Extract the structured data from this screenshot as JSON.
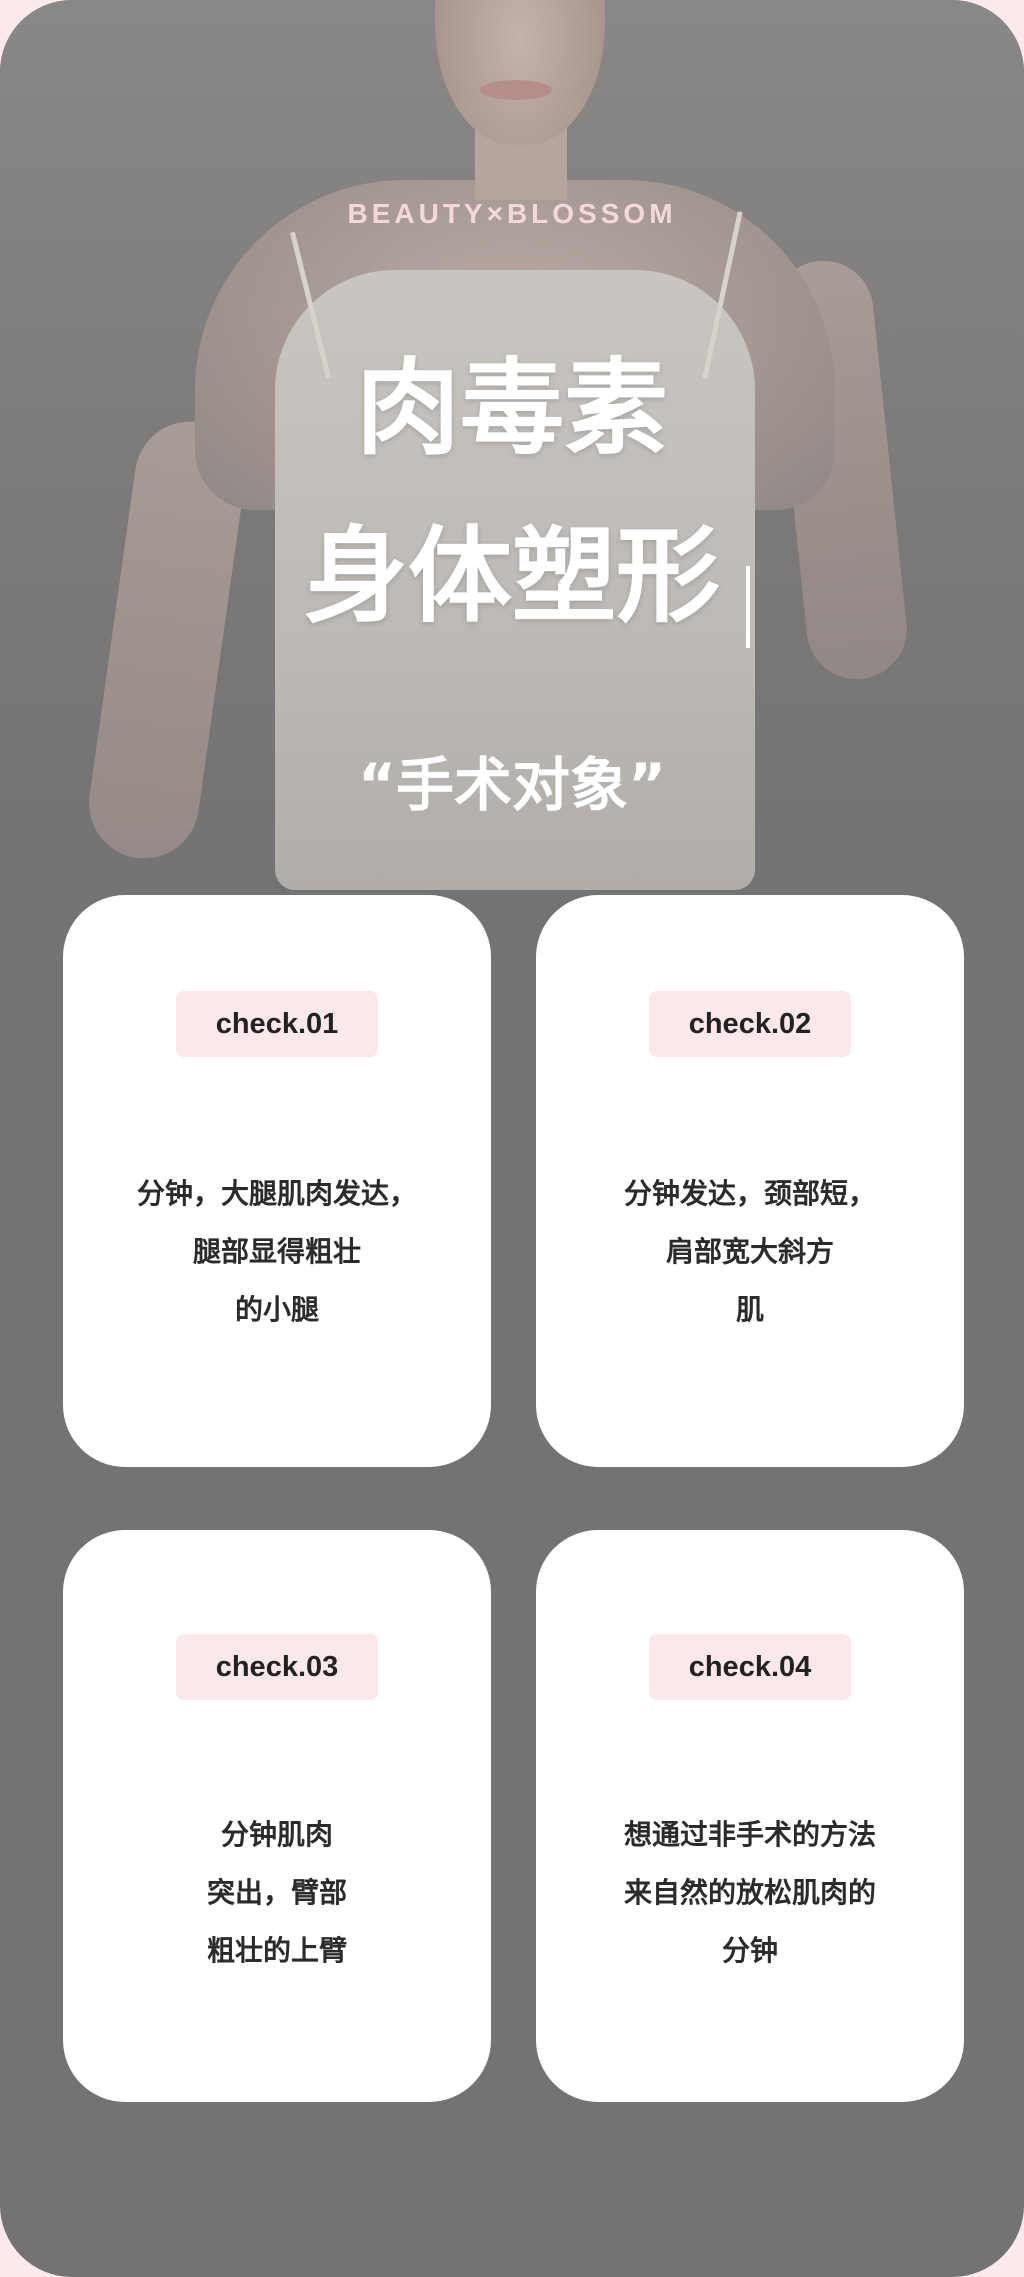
{
  "brand": "BEAUTY×BLOSSOM",
  "title": {
    "line1": "肉毒素",
    "line2": "身体塑形"
  },
  "subtitle": "“手术对象”",
  "cards": [
    {
      "badge": "check.01",
      "lines": [
        "分钟，大腿肌肉发达，",
        "腿部显得粗壮",
        "的小腿"
      ]
    },
    {
      "badge": "check.02",
      "lines": [
        "分钟发达，颈部短，",
        "肩部宽大斜方",
        "肌"
      ]
    },
    {
      "badge": "check.03",
      "lines": [
        "分钟肌肉",
        "突出，臂部",
        "粗壮的上臂"
      ]
    },
    {
      "badge": "check.04",
      "lines": [
        "想通过非手术的方法",
        "来自然的放松肌肉的",
        "分钟"
      ]
    }
  ],
  "colors": {
    "panel": "#737373",
    "card": "#ffffff",
    "badge": "#fce8ea",
    "brand_text": "#f4d7d9",
    "page_bg": "#fbe9ec"
  }
}
